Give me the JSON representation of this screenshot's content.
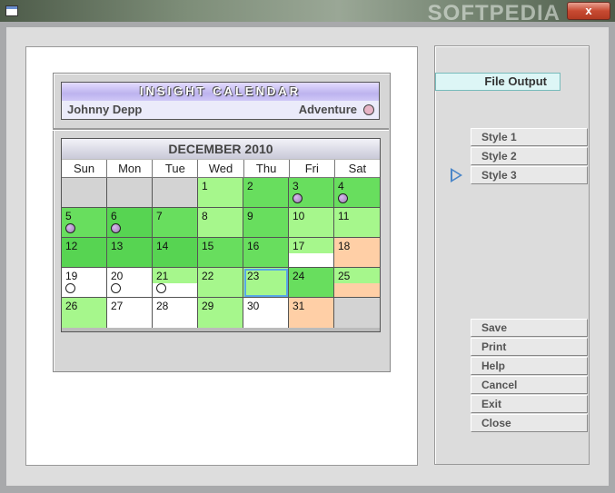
{
  "window": {
    "watermark": "SOFTPEDIA",
    "close_glyph": "x"
  },
  "card": {
    "title": "INSIGHT  CALENDAR",
    "person": "Johnny Depp",
    "category": "Adventure",
    "category_color": "#e7b4c6"
  },
  "calendar": {
    "month_label": "DECEMBER  2010",
    "weekdays": [
      "Sun",
      "Mon",
      "Tue",
      "Wed",
      "Thu",
      "Fri",
      "Sat"
    ],
    "cells": [
      {
        "d": "",
        "bg": "#d3d3d3"
      },
      {
        "d": "",
        "bg": "#d3d3d3"
      },
      {
        "d": "",
        "bg": "#d3d3d3"
      },
      {
        "d": "1",
        "bg": "#a6f78c"
      },
      {
        "d": "2",
        "bg": "#68de5e"
      },
      {
        "d": "3",
        "bg": "#68de5e",
        "ev": "pink"
      },
      {
        "d": "4",
        "bg": "#68de5e",
        "ev": "pink"
      },
      {
        "d": "5",
        "bg": "#68de5e",
        "ev": "pink"
      },
      {
        "d": "6",
        "bg": "#57d452",
        "ev": "pink"
      },
      {
        "d": "7",
        "bg": "#68de5e"
      },
      {
        "d": "8",
        "bg": "#a6f78c"
      },
      {
        "d": "9",
        "bg": "#68de5e"
      },
      {
        "d": "10",
        "bg": "#a6f78c"
      },
      {
        "d": "11",
        "bg": "#a6f78c"
      },
      {
        "d": "12",
        "bg": "#57d452"
      },
      {
        "d": "13",
        "bg": "#57d452"
      },
      {
        "d": "14",
        "bg": "#57d452"
      },
      {
        "d": "15",
        "bg": "#68de5e"
      },
      {
        "d": "16",
        "bg": "#68de5e"
      },
      {
        "d": "17",
        "bg": "#a6f78c",
        "lower": "#ffffff"
      },
      {
        "d": "18",
        "bg": "#ffcfa6"
      },
      {
        "d": "19",
        "bg": "#ffffff",
        "ev": "white"
      },
      {
        "d": "20",
        "bg": "#ffffff",
        "ev": "white"
      },
      {
        "d": "21",
        "bg": "#a6f78c",
        "ev": "white",
        "lower": "#ffffff"
      },
      {
        "d": "22",
        "bg": "#a6f78c"
      },
      {
        "d": "23",
        "bg": "#a6f78c",
        "selected": true
      },
      {
        "d": "24",
        "bg": "#68de5e"
      },
      {
        "d": "25",
        "bg": "#a6f78c",
        "lower": "#ffcfa6"
      },
      {
        "d": "26",
        "bg": "#a6f78c"
      },
      {
        "d": "27",
        "bg": "#ffffff"
      },
      {
        "d": "28",
        "bg": "#ffffff"
      },
      {
        "d": "29",
        "bg": "#a6f78c"
      },
      {
        "d": "30",
        "bg": "#ffffff"
      },
      {
        "d": "31",
        "bg": "#ffcfa6"
      },
      {
        "d": "",
        "bg": "#d3d3d3"
      }
    ]
  },
  "panel": {
    "file_output": "File Output",
    "styles": [
      "Style  1",
      "Style  2",
      "Style  3"
    ],
    "selected_style_index": 2,
    "actions": [
      "Save",
      "Print",
      "Help",
      "Cancel",
      "Exit",
      "Close"
    ]
  }
}
